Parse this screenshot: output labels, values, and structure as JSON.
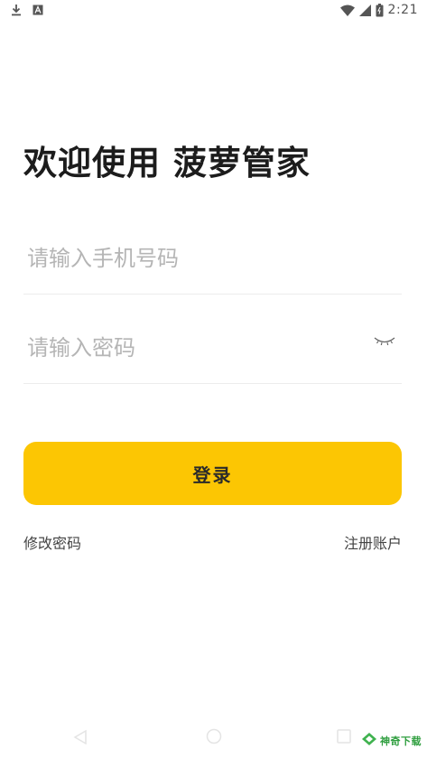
{
  "status_bar": {
    "time": "2:21",
    "left_icons": [
      "download-icon",
      "app-notification-icon"
    ],
    "right_icons": [
      "wifi-icon",
      "signal-icon",
      "battery-icon"
    ]
  },
  "login": {
    "title": "欢迎使用 菠萝管家",
    "phone_placeholder": "请输入手机号码",
    "phone_value": "",
    "password_placeholder": "请输入密码",
    "password_value": "",
    "login_button": "登录",
    "change_password": "修改密码",
    "register": "注册账户"
  },
  "colors": {
    "accent": "#fcc603",
    "title": "#1c1c1c",
    "placeholder": "#b5b5b5"
  },
  "watermark": {
    "text": "神奇下载"
  }
}
